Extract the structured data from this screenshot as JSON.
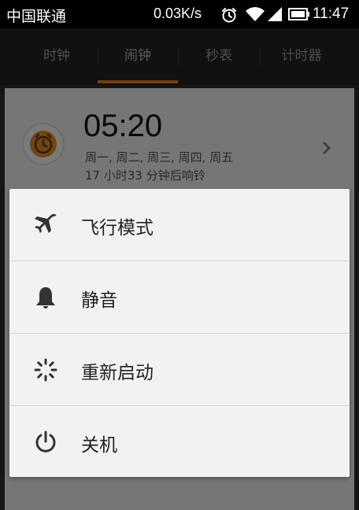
{
  "status_bar": {
    "carrier": "中国联通",
    "net_speed": "0.03K/s",
    "time": "11:47",
    "icons": [
      "alarm-clock-icon",
      "wifi-icon",
      "signal-icon",
      "battery-icon"
    ]
  },
  "tabs": [
    {
      "label": "时钟",
      "active": false
    },
    {
      "label": "闹钟",
      "active": true
    },
    {
      "label": "秒表",
      "active": false
    },
    {
      "label": "计时器",
      "active": false
    }
  ],
  "alarm": {
    "time": "05:20",
    "days": "周一, 周二, 周三, 周四, 周五",
    "remaining": "17 小时33 分钟后响铃",
    "icon": "alarm-clock-icon"
  },
  "power_menu": {
    "items": [
      {
        "label": "飞行模式",
        "icon": "airplane-icon"
      },
      {
        "label": "静音",
        "icon": "bell-icon"
      },
      {
        "label": "重新启动",
        "icon": "restart-spinner-icon"
      },
      {
        "label": "关机",
        "icon": "power-icon"
      }
    ]
  },
  "colors": {
    "accent": "#e67e1a",
    "status_bar_bg": "#000000",
    "tab_bar_bg": "#232323",
    "menu_bg": "#f2f2f2"
  }
}
